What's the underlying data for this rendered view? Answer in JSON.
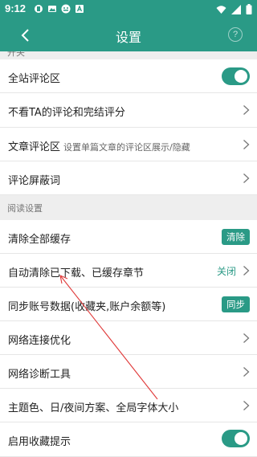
{
  "status_bar": {
    "time": "9:12",
    "icons": [
      "badge-icon",
      "image-icon",
      "notification-icon",
      "text-icon"
    ],
    "right_icons": [
      "wifi-icon",
      "signal-icon",
      "battery-icon"
    ]
  },
  "app_bar": {
    "title": "设置",
    "help_label": "?"
  },
  "sections": {
    "cut_off_header": "开关",
    "reading_header": "阅读设置"
  },
  "rows": {
    "site_comments": "全站评论区",
    "hide_ta": "不看TA的评论和完结评分",
    "article_comments": "文章评论区",
    "article_comments_sub": "设置单篇文章的评论区展示/隐藏",
    "comment_block": "评论屏蔽词",
    "clear_cache": "清除全部缓存",
    "clear_cache_btn": "清除",
    "auto_clear": "自动清除已下载、已缓存章节",
    "auto_clear_status": "关闭",
    "sync_account": "同步账号数据(收藏夹,账户余额等)",
    "sync_btn": "同步",
    "network_opt": "网络连接优化",
    "network_diag": "网络诊断工具",
    "theme": "主题色、日/夜间方案、全局字体大小",
    "fav_hint": "启用收藏提示"
  },
  "colors": {
    "accent": "#2a9a86",
    "annotation_arrow": "#e03a3a"
  }
}
